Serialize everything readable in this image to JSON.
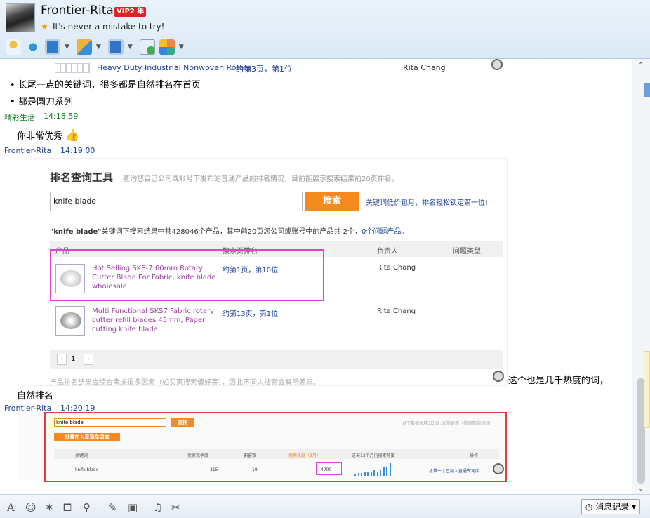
{
  "header": {
    "username": "Frontier-Rita",
    "vip": "VIP2 年",
    "motto": "It's never a mistake to try!"
  },
  "toolbar": {
    "icons": [
      "mic-icon",
      "video-icon",
      "screen-share-icon",
      "file-transfer-icon",
      "remote-assist-icon",
      "add-chat-icon",
      "apps-icon"
    ]
  },
  "chat": {
    "top_snippet": {
      "title": "Heavy Duty Industrial Nonwoven Rotary",
      "rank": "约第3页，第1位",
      "owner": "Rita Chang"
    },
    "bullets": [
      "长尾一点的关键词，很多都是自然排名在首页",
      "都是圆刀系列"
    ],
    "msg1": {
      "sender": "精彩生活",
      "time": "14:18:59",
      "text": "你非常优秀"
    },
    "msg2": {
      "sender": "Frontier-Rita",
      "time": "14:19:00"
    },
    "msg3_text_a": "这个也是几千热度的词，",
    "msg3_text_b": "自然排名",
    "msg4": {
      "sender": "Frontier-Rita",
      "time": "14:20:19"
    }
  },
  "rank_tool": {
    "title": "排名查询工具",
    "desc": "查询您自己公司或账号下发布的普通产品的排名情况，目前能展示搜索结果前20页排名。",
    "query": "knife blade",
    "search_btn": "搜索",
    "promo": "关键词低价包月，排名轻松锁定第一位!",
    "summary_kw": "\"knife blade\"",
    "summary_rest": "关键词下搜索结果中共428046个产品，其中前20页您公司或账号中的产品共 2个，",
    "summary_issue": "0个问题产品。",
    "cols": [
      "产品",
      "搜索页排名",
      "负责人",
      "问题类型"
    ],
    "rows": [
      {
        "name": "Hot Selling SKS-7 60mm Rotary Cutter Blade For Fabric, knife blade wholesale",
        "rank": "约第1页，第10位",
        "owner": "Rita Chang"
      },
      {
        "name": "Multi Functional SKS7 Fabric rotary cutter refill blades 45mm, Paper cutting knife blade",
        "rank": "约第13页，第1位",
        "owner": "Rita Chang"
      }
    ],
    "page": "1",
    "note": "产品排名结果会综合考虑很多因素（如买家搜索偏好等），因此不同人搜索会有所差异。"
  },
  "kw_tool": {
    "query": "knife blade",
    "btn": "查找",
    "batch_btn": "批量加入直通车词库",
    "note": "以下数据每月3日09:00前更新（美国西部时间）",
    "cols": [
      "关键词",
      "卖家竞争度",
      "橱窗数",
      "搜索热度（3月）",
      "过去12个月内搜索热度",
      "操作"
    ],
    "row": {
      "kw": "knife blade",
      "competition": "315",
      "windows": "19",
      "heat": "4700",
      "action": "抢第一 | 已加入直通车词库"
    },
    "bars": [
      2,
      3,
      3,
      4,
      4,
      5,
      6,
      5,
      7,
      9,
      10,
      14
    ]
  },
  "bottom": {
    "icons": [
      "font-icon",
      "emoji-icon",
      "magic-icon",
      "screenshot-icon",
      "voice-icon",
      "edit-icon",
      "image-icon",
      "music-icon",
      "scissors-icon"
    ],
    "history": "消息记录"
  }
}
